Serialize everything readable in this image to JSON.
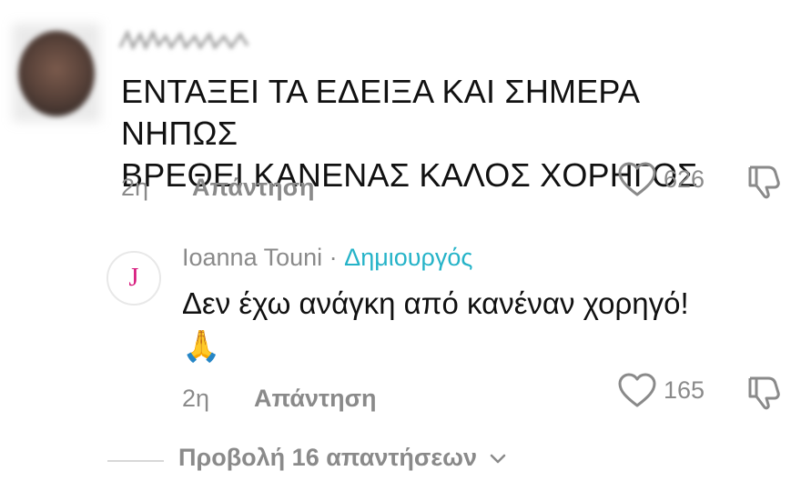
{
  "comment": {
    "text_line1": "ΕΝΤΑΞΕΙ ΤΑ ΕΔΕΙΞΑ ΚΑΙ ΣΗΜΕΡΑ ΝΗΠΩΣ",
    "text_line2": "ΒΡΕΘΕΙ ΚΑΝΕΝΑΣ ΚΑΛΟΣ ΧΟΡΗΓΟΣ",
    "time": "2η",
    "reply_label": "Απάντηση",
    "like_count": "626"
  },
  "reply": {
    "avatar_letter": "J",
    "author": "Ioanna Touni",
    "separator": " · ",
    "creator_label": "Δημιουργός",
    "text": "Δεν έχω ανάγκη από κανέναν χορηγό!",
    "emoji": "🙏",
    "time": "2η",
    "reply_label": "Απάντηση",
    "like_count": "165"
  },
  "view_replies": {
    "label": "Προβολή 16 απαντήσεων"
  },
  "colors": {
    "text": "#111111",
    "muted": "#8a8a8a",
    "creator": "#25b3c8",
    "avatar_letter": "#d6157a"
  }
}
